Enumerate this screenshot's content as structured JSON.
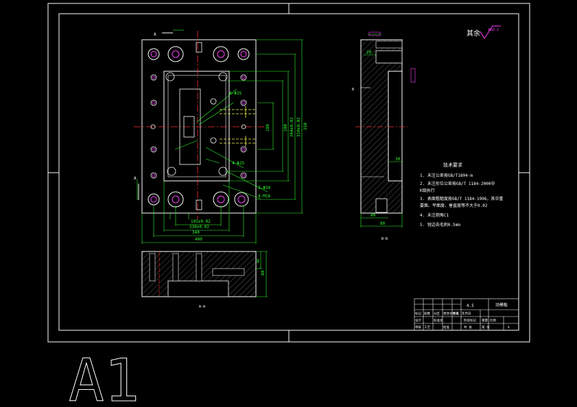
{
  "drawing": {
    "roughness_symbol": "其余",
    "roughness_value": "Ra3.2",
    "size_label": "A1",
    "section_labels": {
      "bottom_view": "A-A",
      "side_view": "B-B"
    },
    "section_markers": {
      "top_left": "A",
      "bottom_left": "A",
      "right_side": "B"
    },
    "dimensions": {
      "overall_width": "400",
      "inner_width": "340",
      "width_tol1": "230±0.02",
      "width_tol2": "195±0.02",
      "width_small": "180",
      "height_total": "350",
      "height_a": "310±0.02",
      "height_b": "264±0.02",
      "height_c": "200",
      "side_width": "80",
      "side_inner": "40",
      "side_r": "30",
      "side_top": "20",
      "section_height": "80",
      "section_inner": "40"
    },
    "leaders": {
      "hole1": "4-Φ35",
      "hole2": "4-Φ25",
      "hole3": "2-Φ30",
      "hole4": "4-M16"
    }
  },
  "notes": {
    "title": "技术要求",
    "items": [
      "1. 未注公差按GB/T1804-m",
      "2. 未注形位公差按GB/T 1184-2000中",
      "   K级执行",
      "3. 表面粗糙度按GB/T 1184-1996，其中重",
      "   要面、平面度、垂直度等不大于0.02",
      "4. 未注倒角C1",
      "5. 锐边去毛刺0.5mm"
    ]
  },
  "title_block": {
    "scale": "4.5",
    "part_name": "动模板",
    "row_labels": [
      "标记",
      "处数",
      "分区",
      "更改文件号",
      "签名",
      "年月日"
    ],
    "row2": [
      "设计",
      "",
      "标准化",
      "",
      "阶段标记",
      "重量",
      "比例"
    ],
    "row3": [
      "审核",
      "",
      "",
      "",
      "",
      "",
      ""
    ],
    "row4": [
      "工艺",
      "",
      "批准",
      "",
      "共 张",
      "第 张",
      "A"
    ]
  }
}
